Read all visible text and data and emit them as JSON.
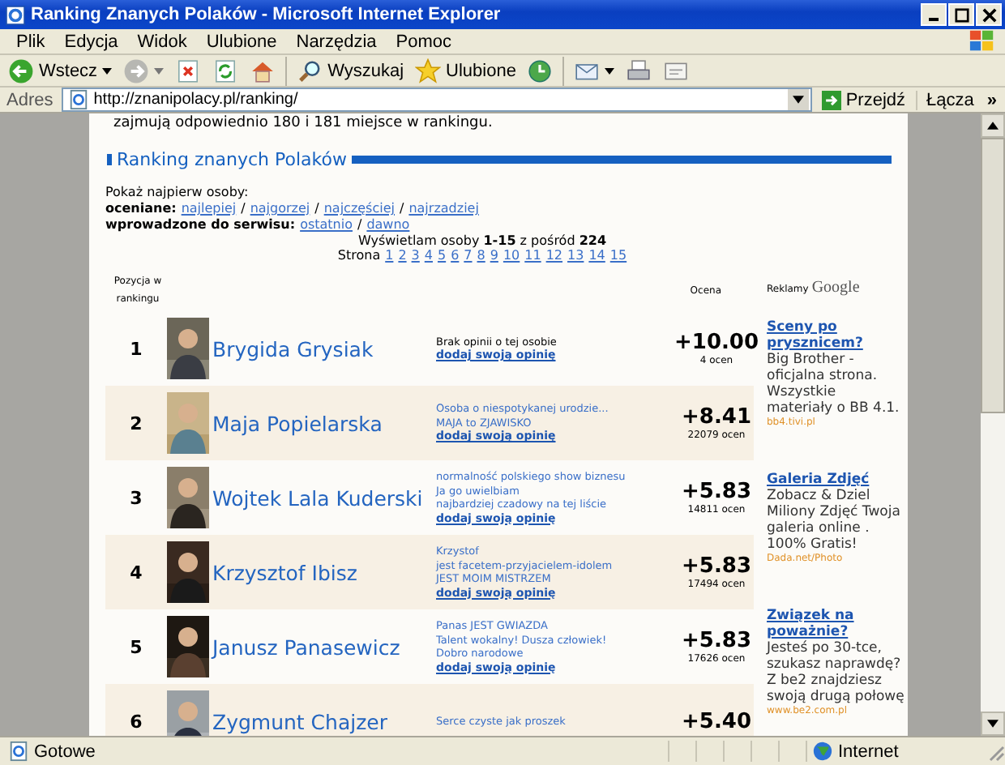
{
  "window": {
    "title": "Ranking Znanych Polaków - Microsoft Internet Explorer"
  },
  "menu": [
    "Plik",
    "Edycja",
    "Widok",
    "Ulubione",
    "Narzędzia",
    "Pomoc"
  ],
  "toolbar": {
    "back": "Wstecz",
    "search": "Wyszukaj",
    "favorites": "Ulubione"
  },
  "address_bar": {
    "label": "Adres",
    "value": "http://znanipolacy.pl/ranking/",
    "go": "Przejdź",
    "links": "Łącza",
    "more": "»"
  },
  "page": {
    "intro": "zajmują odpowiednio 180 i 181 miejsce w rankingu.",
    "heading": "Ranking znanych Polaków",
    "sort_prompt": "Pokaż najpierw osoby:",
    "sort_groups": [
      {
        "label": "oceniane:",
        "links": [
          "najlepiej",
          "najgorzej",
          "najczęściej",
          "najrzadziej"
        ]
      },
      {
        "label": "wprowadzone do serwisu:",
        "links": [
          "ostatnio",
          "dawno"
        ]
      }
    ],
    "separator": "/",
    "summary": "Wyświetlam osoby **1-15** z pośród **224**",
    "pages_label": "Strona",
    "pages": [
      "1",
      "2",
      "3",
      "4",
      "5",
      "6",
      "7",
      "8",
      "9",
      "10",
      "11",
      "12",
      "13",
      "14",
      "15"
    ],
    "columns": {
      "position": "Pozycja w rankingu",
      "rating": "Ocena"
    },
    "rows": [
      {
        "rank": "1",
        "name": "Brygida Grysiak",
        "has_opinions": false,
        "opinions": [
          "Brak opinii o tej osobie"
        ],
        "add_opinion": "dodaj swoją opinię",
        "rating": "+10.00",
        "votes": "4 ocen"
      },
      {
        "rank": "2",
        "name": "Maja Popielarska",
        "has_opinions": true,
        "opinions": [
          "Osoba o niespotykanej urodzie...",
          "MAJA to ZJAWISKO"
        ],
        "add_opinion": "dodaj swoją opinię",
        "rating": "+8.41",
        "votes": "22079 ocen"
      },
      {
        "rank": "3",
        "name": "Wojtek Lala Kuderski",
        "has_opinions": true,
        "opinions": [
          "normalność polskiego show biznesu",
          "Ja go uwielbiam",
          "najbardziej czadowy na tej liście"
        ],
        "add_opinion": "dodaj swoją opinię",
        "rating": "+5.83",
        "votes": "14811 ocen"
      },
      {
        "rank": "4",
        "name": "Krzysztof Ibisz",
        "has_opinions": true,
        "opinions": [
          "Krzystof",
          "jest facetem-przyjacielem-idolem",
          "JEST MOIM MISTRZEM"
        ],
        "add_opinion": "dodaj swoją opinię",
        "rating": "+5.83",
        "votes": "17494 ocen"
      },
      {
        "rank": "5",
        "name": "Janusz Panasewicz",
        "has_opinions": true,
        "opinions": [
          "Panas JEST GWIAZDA",
          "Talent wokalny! Dusza człowiek!",
          "Dobro narodowe"
        ],
        "add_opinion": "dodaj swoją opinię",
        "rating": "+5.83",
        "votes": "17626 ocen"
      },
      {
        "rank": "6",
        "name": "Zygmunt Chajzer",
        "has_opinions": true,
        "opinions": [
          "Serce czyste jak proszek"
        ],
        "rating": "+5.40"
      }
    ],
    "ads_label": "Reklamy",
    "ads_brand": "Google",
    "ads": [
      {
        "title": "Sceny po prysznicem?",
        "body": "Big Brother - oficjalna strona. Wszystkie materiały o BB 4.1.",
        "url": "bb4.tivi.pl"
      },
      {
        "title": "Galeria Zdjęć",
        "body": "Zobacz & Dziel Miliony Zdjęć Twoja galeria online . 100% Gratis!",
        "url": "Dada.net/Photo"
      },
      {
        "title": "Związek na poważnie?",
        "body": "Jesteś po 30-tce, szukasz naprawdę? Z be2 znajdziesz swoją drugą połowę",
        "url": "www.be2.com.pl"
      }
    ]
  },
  "status_bar": {
    "text": "Gotowe",
    "zone": "Internet"
  }
}
